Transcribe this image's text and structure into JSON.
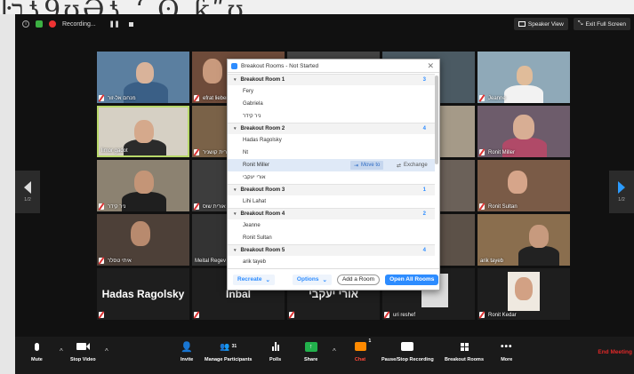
{
  "background": {
    "handwritten": "ŀבƾ9ʊƏƾ ʻ ʘ ƙʺʊ"
  },
  "topbar": {
    "recording_label": "Recording...",
    "speaker_view": "Speaker View",
    "exit_fullscreen": "Exit Full Screen"
  },
  "tiles": [
    {
      "name": "מנחם אל-זור"
    },
    {
      "name": "efrat lieberr"
    },
    {
      "name": ""
    },
    {
      "name": ""
    },
    {
      "name": "Jeanne"
    },
    {
      "name": "limor gadot"
    },
    {
      "name": "עירית קושניר"
    },
    {
      "name": ""
    },
    {
      "name": ""
    },
    {
      "name": "Ronit Miller"
    },
    {
      "name": "ניר קידר"
    },
    {
      "name": "אורית שוס"
    },
    {
      "name": ""
    },
    {
      "name": ""
    },
    {
      "name": "Ronit Sultan"
    },
    {
      "name": "איתי טסלר"
    },
    {
      "name": "Meital Regev"
    },
    {
      "name": ""
    },
    {
      "name": ""
    },
    {
      "name": "arik tayeb"
    },
    {
      "name": "",
      "big": "Hadas Ragolsky"
    },
    {
      "name": "",
      "big": "Inbal"
    },
    {
      "name": "",
      "big": "אורי יעקבי"
    },
    {
      "name": "uri reshef"
    },
    {
      "name": "Ronit Kedar"
    }
  ],
  "pager": {
    "left": "1/2",
    "right": "1/2"
  },
  "breakout": {
    "title": "Breakout Rooms - Not Started",
    "rooms": [
      {
        "label": "Breakout Room 1",
        "count": "3",
        "members": [
          "Fery",
          "Gabriela",
          "ניר קידר"
        ]
      },
      {
        "label": "Breakout Room 2",
        "count": "4",
        "members": [
          "Hadas Ragolsky",
          "Nt",
          "Ronit Miller",
          "אורי יעקבי"
        ]
      },
      {
        "label": "Breakout Room 3",
        "count": "1",
        "members": [
          "Lihi Lahat"
        ]
      },
      {
        "label": "Breakout Room 4",
        "count": "2",
        "members": [
          "Jeanne",
          "Ronit Sultan"
        ]
      },
      {
        "label": "Breakout Room 5",
        "count": "4",
        "members": [
          "arik tayeb"
        ]
      }
    ],
    "move_to": "Move to",
    "exchange": "Exchange",
    "footer": {
      "recreate": "Recreate",
      "options": "Options",
      "add_room": "Add a Room",
      "open_all": "Open All Rooms"
    }
  },
  "toolbar": {
    "mute": "Mute",
    "stop_video": "Stop Video",
    "invite": "Invite",
    "manage_participants": "Manage Participants",
    "participants_count": "31",
    "polls": "Polls",
    "share": "Share",
    "chat": "Chat",
    "chat_badge": "1",
    "pause_stop_recording": "Pause/Stop Recording",
    "breakout_rooms": "Breakout Rooms",
    "more": "More",
    "end_meeting": "End Meeting"
  },
  "colors": {
    "accent": "#2d8cff",
    "end": "#e02828",
    "chat": "#ff8a00",
    "share": "#22b14c"
  }
}
